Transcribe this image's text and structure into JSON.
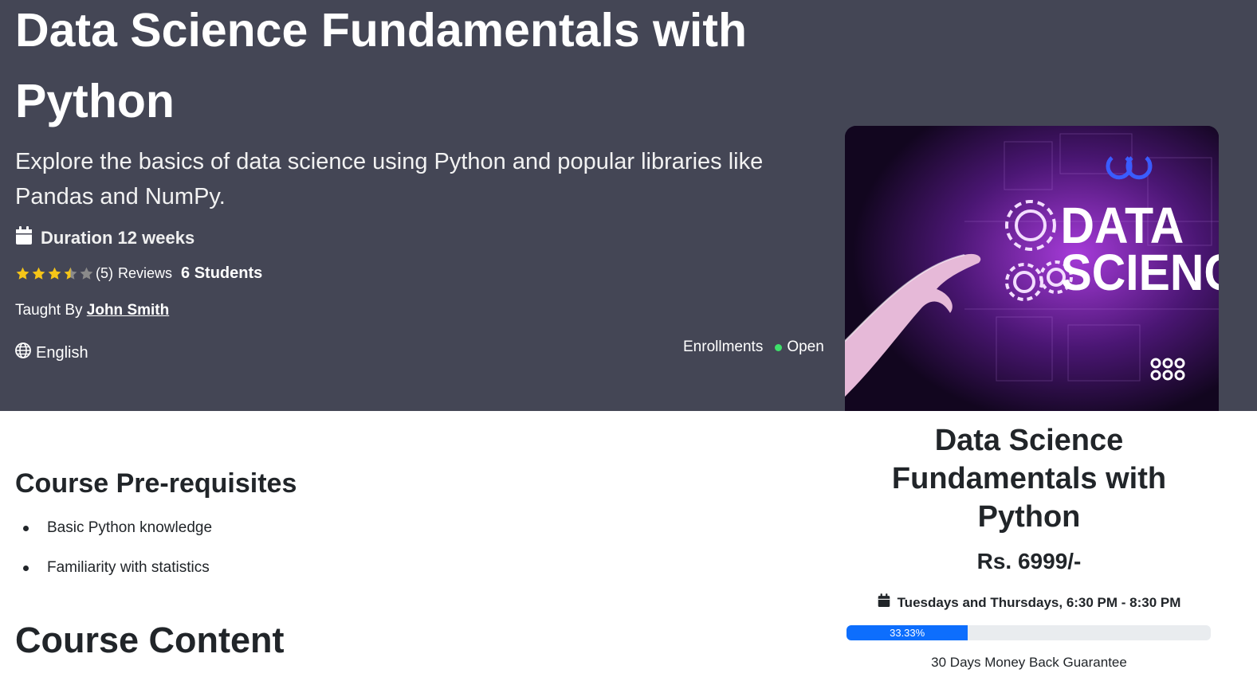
{
  "hero": {
    "title": "Data Science Fundamentals with Python",
    "description": "Explore the basics of data science using Python and popular libraries like Pandas and NumPy.",
    "duration": "Duration 12 weeks",
    "rating": 3.5,
    "rating_count": "(5)",
    "reviews_label": "Reviews",
    "students": "6 Students",
    "taught_by_label": "Taught By",
    "instructor": "John Smith",
    "language": "English",
    "enrollments_label": "Enrollments",
    "enrollment_status": "Open",
    "status_color": "#3ee06a",
    "background": "#444655"
  },
  "image": {
    "text_line1": "DATA",
    "text_line2": "SCIENC"
  },
  "sidebar": {
    "title": "Data Science Fundamentals with Python",
    "price": "Rs. 6999/-",
    "schedule": "Tuesdays and Thursdays, 6:30 PM - 8:30 PM",
    "progress_label": "33.33%",
    "progress_percent": 33.33,
    "guarantee": "30 Days Money Back Guarantee",
    "accent": "#0d6efd"
  },
  "main": {
    "prereq_title": "Course Pre-requisites",
    "prereqs": [
      "Basic Python knowledge",
      "Familiarity with statistics"
    ],
    "content_title": "Course Content"
  }
}
